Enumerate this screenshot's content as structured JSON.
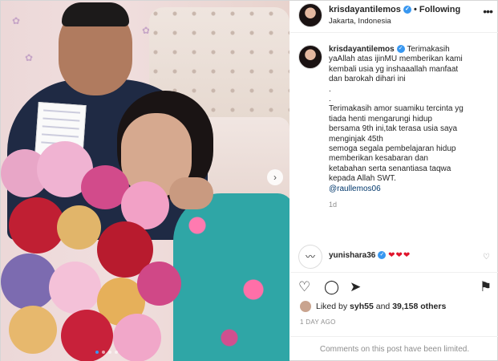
{
  "post": {
    "username": "krisdayantilemos",
    "verified_mark": "✓",
    "separator": "•",
    "following": "Following",
    "location": "Jakarta, Indonesia",
    "more": "•••",
    "caption_lines": [
      "Terimakasih",
      "yaAllah atas ijinMU memberikan kami",
      "kembali usia yg inshaaallah manfaat",
      "dan barokah dihari ini",
      ".",
      ".",
      "Terimakasih amor suamiku tercinta yg",
      "tiada henti mengarungi hidup",
      "bersama 9th ini,tak terasa usia saya",
      "menginjak 45th",
      "semoga segala pembelajaran hidup",
      "memberikan kesabaran dan",
      "ketabahan serta senantiasa taqwa",
      "kepada Allah SWT."
    ],
    "mention": "@raullemos06",
    "caption_time": "1d",
    "comment": {
      "username": "yunishara36",
      "text": "❤❤❤",
      "like_icon": "♡",
      "avatar_glyph": "〰"
    },
    "actions": {
      "like": "♡",
      "comment": "◯",
      "share": "➤",
      "save": "⚑"
    },
    "likes": {
      "prefix": "Liked by ",
      "user": "syh55",
      "middle": " and ",
      "count": "39,158 others"
    },
    "posted": "1 DAY AGO",
    "comments_limited": "Comments on this post have been limited.",
    "carousel": {
      "current": 1,
      "total": 4,
      "next_glyph": "›"
    }
  },
  "colors": {
    "accent": "#3897f0",
    "heart": "#e0142b",
    "muted": "#8e8e8e"
  }
}
